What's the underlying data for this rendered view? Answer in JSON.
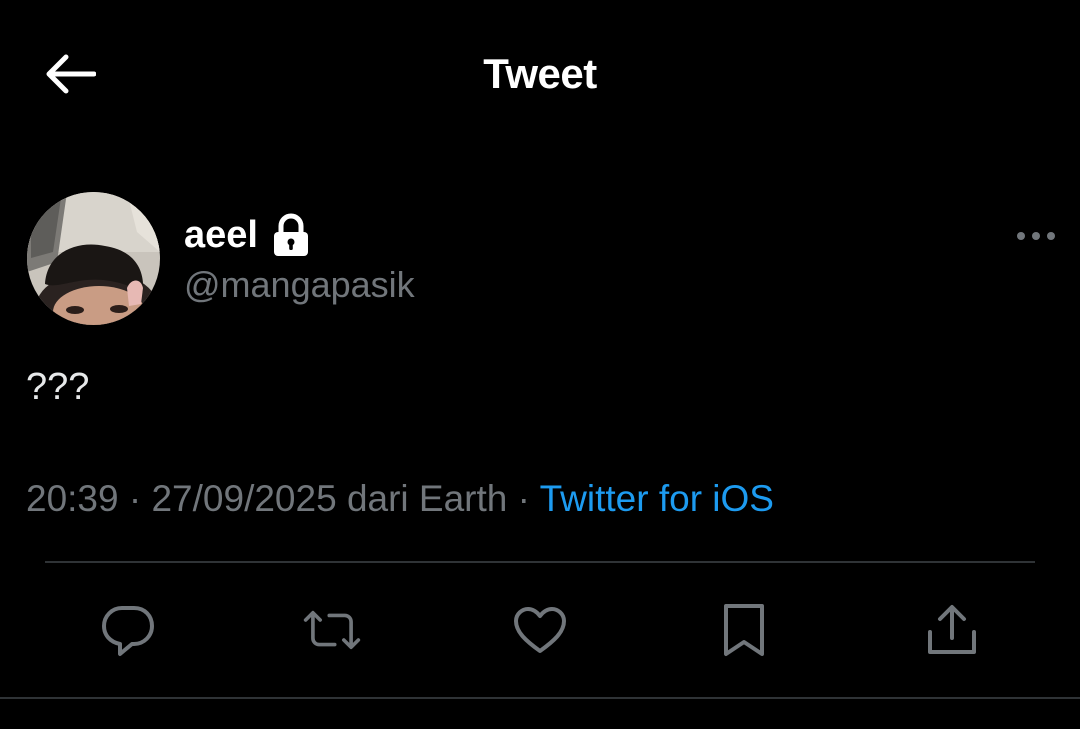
{
  "header": {
    "title": "Tweet",
    "back_icon": "arrow-left-icon"
  },
  "author": {
    "display_name": "aeel",
    "protected_icon": "lock-icon",
    "handle": "@mangapasik"
  },
  "tweet": {
    "text": "???",
    "time": "20:39",
    "date": "27/09/2025",
    "location": "dari Earth",
    "separator": "·",
    "source": "Twitter for iOS"
  },
  "actions": {
    "items": [
      {
        "name": "reply",
        "icon": "reply-icon"
      },
      {
        "name": "retweet",
        "icon": "retweet-icon"
      },
      {
        "name": "like",
        "icon": "heart-icon"
      },
      {
        "name": "bookmark",
        "icon": "bookmark-icon"
      },
      {
        "name": "share",
        "icon": "share-icon"
      }
    ]
  },
  "colors": {
    "background": "#000000",
    "primary_text": "#e7e9ea",
    "secondary_text": "#71767b",
    "accent": "#1d9bf0",
    "divider": "#2f3336"
  }
}
